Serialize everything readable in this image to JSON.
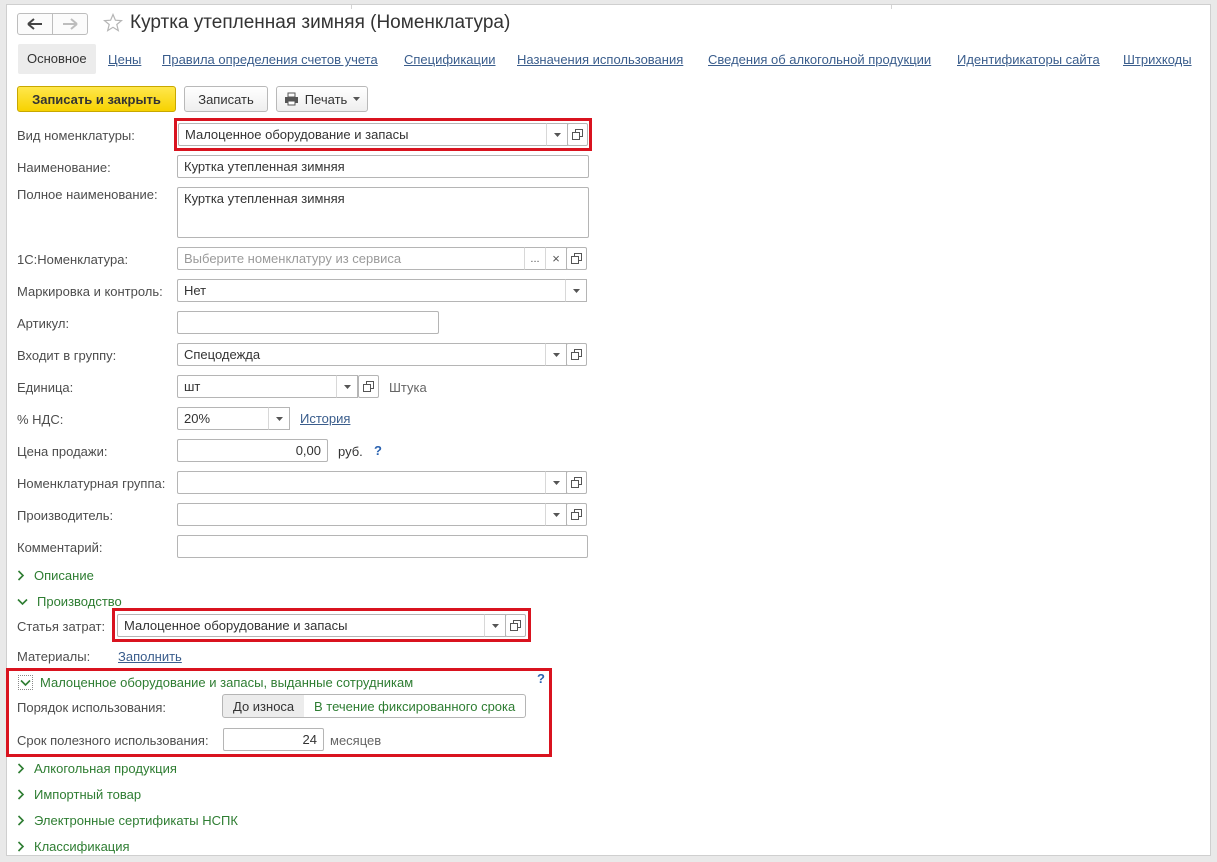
{
  "window": {
    "title": "Куртка утепленная зимняя (Номенклатура)"
  },
  "tabs": [
    {
      "label": "Основное",
      "active": true
    },
    {
      "label": "Цены"
    },
    {
      "label": "Правила определения счетов учета"
    },
    {
      "label": "Спецификации"
    },
    {
      "label": "Назначения использования"
    },
    {
      "label": "Сведения об алкогольной продукции"
    },
    {
      "label": "Идентификаторы сайта"
    },
    {
      "label": "Штрихкоды"
    }
  ],
  "toolbar": {
    "save_close": "Записать и закрыть",
    "save": "Записать",
    "print": "Печать"
  },
  "form": {
    "vid": {
      "label": "Вид номенклатуры:",
      "value": "Малоценное оборудование и запасы"
    },
    "name": {
      "label": "Наименование:",
      "value": "Куртка утепленная зимняя"
    },
    "fullname": {
      "label": "Полное наименование:",
      "value": "Куртка утепленная зимняя"
    },
    "onec": {
      "label": "1С:Номенклатура:",
      "placeholder": "Выберите номенклатуру из сервиса",
      "ellipsis": "...",
      "clear": "×"
    },
    "marking": {
      "label": "Маркировка и контроль:",
      "value": "Нет"
    },
    "article": {
      "label": "Артикул:",
      "value": ""
    },
    "group": {
      "label": "Входит в группу:",
      "value": "Спецодежда"
    },
    "unit": {
      "label": "Единица:",
      "value": "шт",
      "full": "Штука"
    },
    "vat": {
      "label": "% НДС:",
      "value": "20%",
      "history": "История"
    },
    "price": {
      "label": "Цена продажи:",
      "value": "0,00",
      "currency": "руб.",
      "hint": "?"
    },
    "nomgroup": {
      "label": "Номенклатурная группа:",
      "value": ""
    },
    "manufacturer": {
      "label": "Производитель:",
      "value": ""
    },
    "comment": {
      "label": "Комментарий:",
      "value": ""
    }
  },
  "sections": {
    "description": "Описание",
    "production": "Производство",
    "cost_item": {
      "label": "Статья затрат:",
      "value": "Малоценное оборудование и запасы"
    },
    "materials": {
      "label": "Материалы:",
      "link": "Заполнить"
    },
    "mbp": {
      "title": "Малоценное оборудование и запасы, выданные сотрудникам",
      "hint": "?",
      "usage_label": "Порядок использования:",
      "usage_options": [
        "До износа",
        "В течение фиксированного срока"
      ],
      "term_label": "Срок полезного использования:",
      "term_value": "24",
      "term_unit": "месяцев"
    },
    "alcohol": "Алкогольная продукция",
    "import": "Импортный товар",
    "certificates": "Электронные сертификаты НСПК",
    "classification": "Классификация"
  },
  "icons": {
    "back": "arrow-left-icon",
    "forward": "arrow-right-icon",
    "star": "star-icon",
    "printer": "printer-icon",
    "dropdown": "chevron-down-icon",
    "open": "open-window-icon",
    "expand": "chevron-right-icon",
    "collapse": "chevron-down-icon"
  },
  "colors": {
    "accent_yellow": "#f7d200",
    "link_blue": "#3a5d8c",
    "group_green": "#2e7d32",
    "highlight_red": "#d9131f"
  }
}
